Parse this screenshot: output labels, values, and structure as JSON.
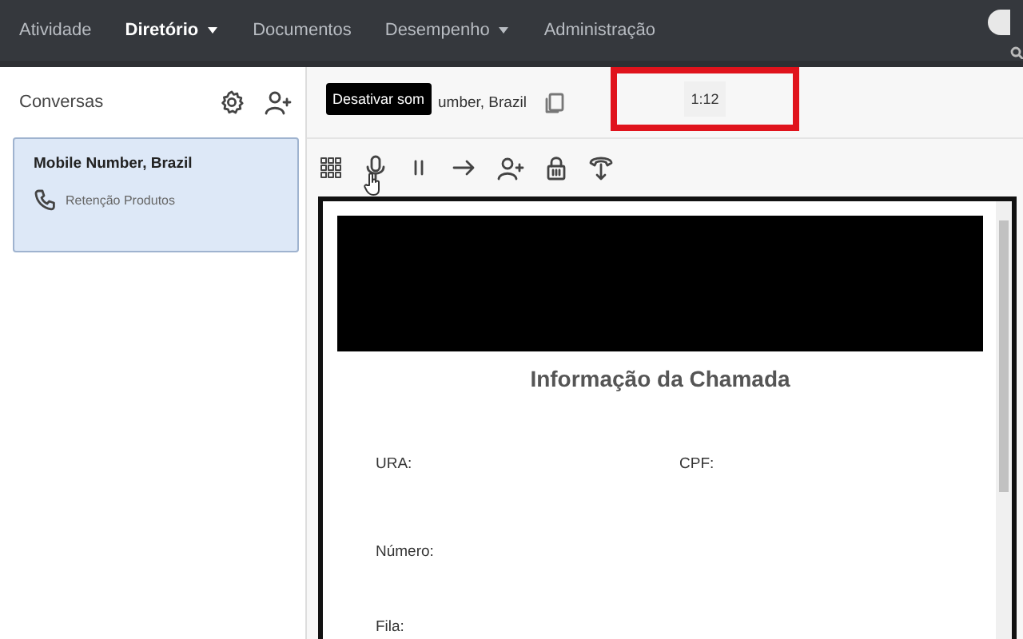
{
  "nav": {
    "items": [
      {
        "label": "Atividade",
        "selected": false,
        "dropdown": false
      },
      {
        "label": "Diretório",
        "selected": true,
        "dropdown": true
      },
      {
        "label": "Documentos",
        "selected": false,
        "dropdown": false
      },
      {
        "label": "Desempenho",
        "selected": false,
        "dropdown": true
      },
      {
        "label": "Administração",
        "selected": false,
        "dropdown": false
      }
    ]
  },
  "sidebar": {
    "title": "Conversas",
    "conversations": [
      {
        "name": "Mobile Number, Brazil",
        "queue": "Retenção Produtos",
        "selected": true
      }
    ]
  },
  "call": {
    "name": "umber, Brazil",
    "timer": "1:12",
    "tooltip": "Desativar som"
  },
  "form": {
    "title": "Informação da Chamada",
    "rows": [
      [
        "URA:",
        "CPF:"
      ],
      [
        "Número:"
      ],
      [
        "Fila:"
      ]
    ]
  }
}
